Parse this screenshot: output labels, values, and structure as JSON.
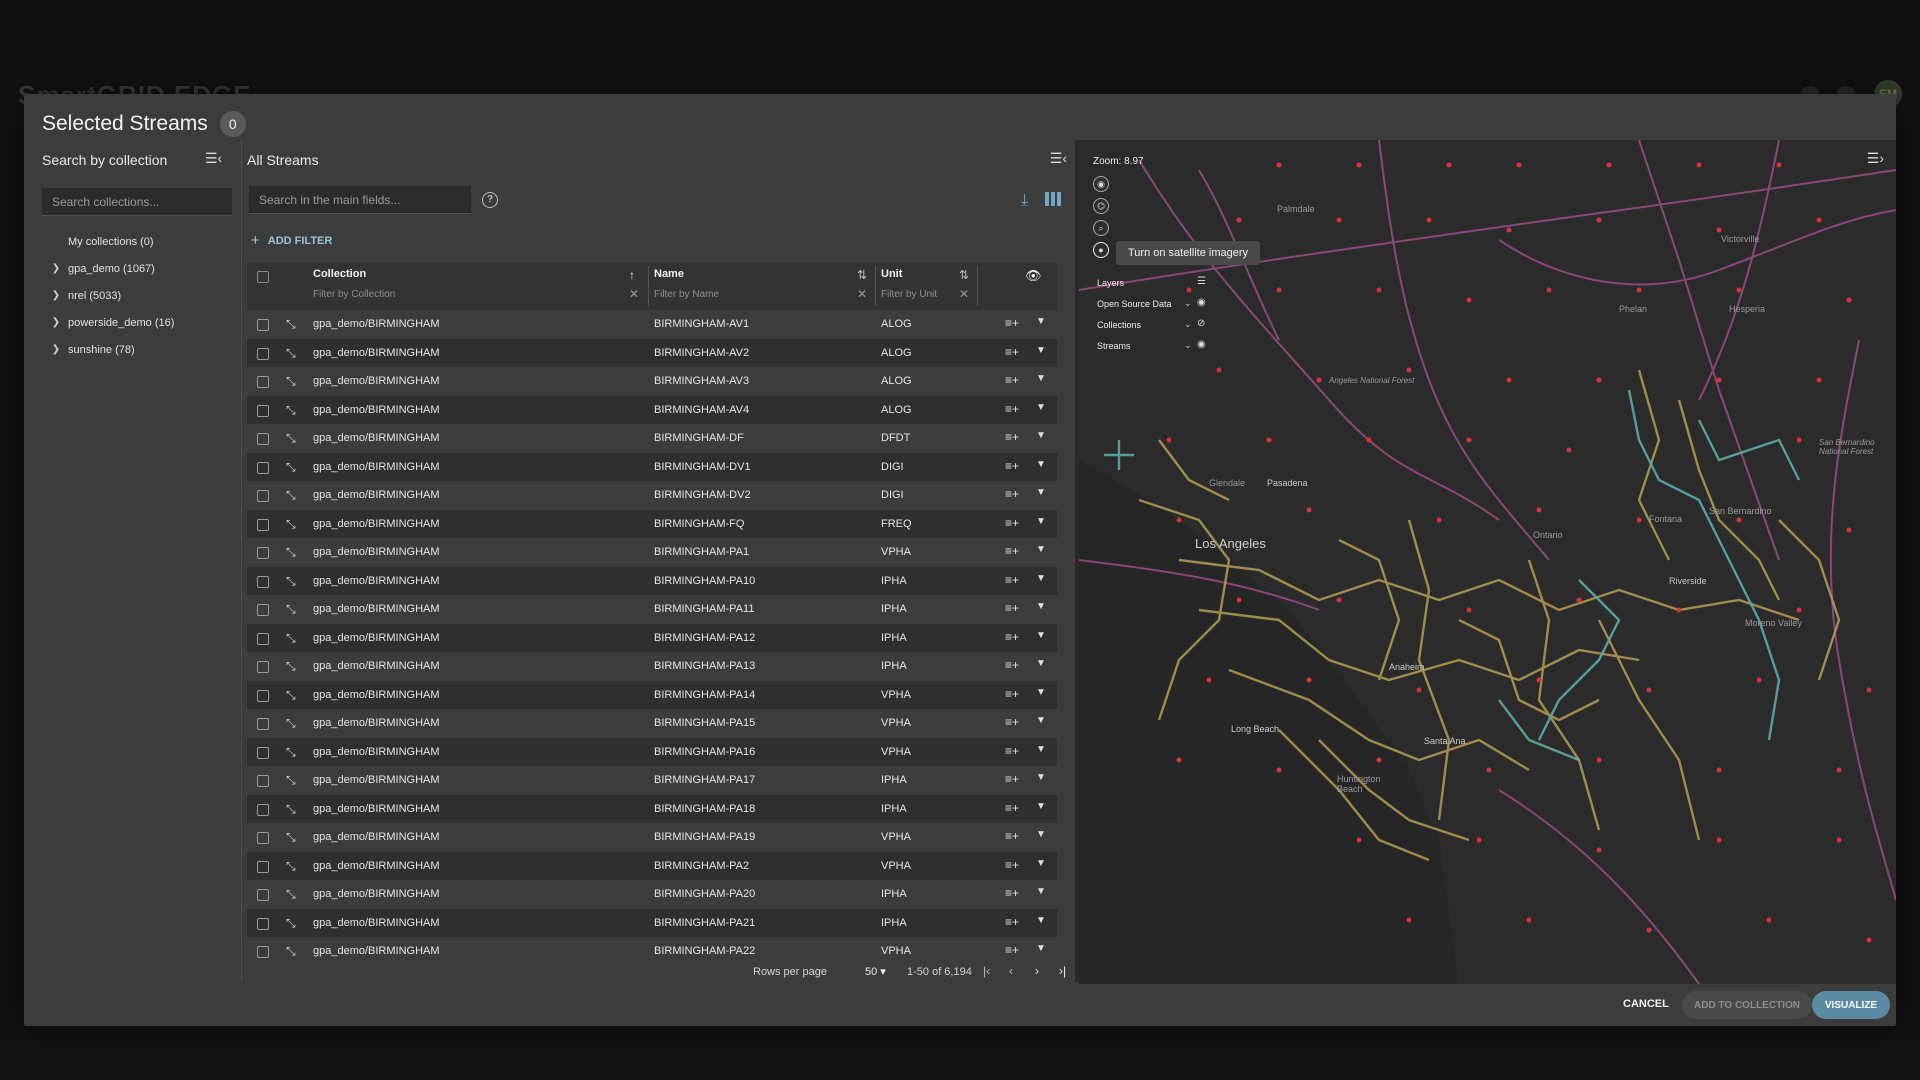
{
  "background": {
    "app_title": "SmartGRID EDGE",
    "avatar": "EM"
  },
  "dialog": {
    "title": "Selected Streams",
    "selected_count": "0"
  },
  "left_panel": {
    "title": "Search by collection",
    "search_placeholder": "Search collections...",
    "items": [
      {
        "label": "My collections (0)",
        "expandable": false
      },
      {
        "label": "gpa_demo (1067)",
        "expandable": true
      },
      {
        "label": "nrel (5033)",
        "expandable": true
      },
      {
        "label": "powerside_demo (16)",
        "expandable": true
      },
      {
        "label": "sunshine (78)",
        "expandable": true
      }
    ]
  },
  "streams": {
    "title": "All Streams",
    "search_placeholder": "Search in the main fields...",
    "add_filter_label": "ADD FILTER",
    "columns": {
      "collection": "Collection",
      "collection_filter": "Filter by Collection",
      "name": "Name",
      "name_filter": "Filter by Name",
      "unit": "Unit",
      "unit_filter": "Filter by Unit"
    },
    "rows": [
      {
        "collection": "gpa_demo/BIRMINGHAM",
        "name": "BIRMINGHAM-AV1",
        "unit": "ALOG"
      },
      {
        "collection": "gpa_demo/BIRMINGHAM",
        "name": "BIRMINGHAM-AV2",
        "unit": "ALOG"
      },
      {
        "collection": "gpa_demo/BIRMINGHAM",
        "name": "BIRMINGHAM-AV3",
        "unit": "ALOG"
      },
      {
        "collection": "gpa_demo/BIRMINGHAM",
        "name": "BIRMINGHAM-AV4",
        "unit": "ALOG"
      },
      {
        "collection": "gpa_demo/BIRMINGHAM",
        "name": "BIRMINGHAM-DF",
        "unit": "DFDT"
      },
      {
        "collection": "gpa_demo/BIRMINGHAM",
        "name": "BIRMINGHAM-DV1",
        "unit": "DIGI"
      },
      {
        "collection": "gpa_demo/BIRMINGHAM",
        "name": "BIRMINGHAM-DV2",
        "unit": "DIGI"
      },
      {
        "collection": "gpa_demo/BIRMINGHAM",
        "name": "BIRMINGHAM-FQ",
        "unit": "FREQ"
      },
      {
        "collection": "gpa_demo/BIRMINGHAM",
        "name": "BIRMINGHAM-PA1",
        "unit": "VPHA"
      },
      {
        "collection": "gpa_demo/BIRMINGHAM",
        "name": "BIRMINGHAM-PA10",
        "unit": "IPHA"
      },
      {
        "collection": "gpa_demo/BIRMINGHAM",
        "name": "BIRMINGHAM-PA11",
        "unit": "IPHA"
      },
      {
        "collection": "gpa_demo/BIRMINGHAM",
        "name": "BIRMINGHAM-PA12",
        "unit": "IPHA"
      },
      {
        "collection": "gpa_demo/BIRMINGHAM",
        "name": "BIRMINGHAM-PA13",
        "unit": "IPHA"
      },
      {
        "collection": "gpa_demo/BIRMINGHAM",
        "name": "BIRMINGHAM-PA14",
        "unit": "VPHA"
      },
      {
        "collection": "gpa_demo/BIRMINGHAM",
        "name": "BIRMINGHAM-PA15",
        "unit": "VPHA"
      },
      {
        "collection": "gpa_demo/BIRMINGHAM",
        "name": "BIRMINGHAM-PA16",
        "unit": "VPHA"
      },
      {
        "collection": "gpa_demo/BIRMINGHAM",
        "name": "BIRMINGHAM-PA17",
        "unit": "IPHA"
      },
      {
        "collection": "gpa_demo/BIRMINGHAM",
        "name": "BIRMINGHAM-PA18",
        "unit": "IPHA"
      },
      {
        "collection": "gpa_demo/BIRMINGHAM",
        "name": "BIRMINGHAM-PA19",
        "unit": "VPHA"
      },
      {
        "collection": "gpa_demo/BIRMINGHAM",
        "name": "BIRMINGHAM-PA2",
        "unit": "VPHA"
      },
      {
        "collection": "gpa_demo/BIRMINGHAM",
        "name": "BIRMINGHAM-PA20",
        "unit": "IPHA"
      },
      {
        "collection": "gpa_demo/BIRMINGHAM",
        "name": "BIRMINGHAM-PA21",
        "unit": "IPHA"
      },
      {
        "collection": "gpa_demo/BIRMINGHAM",
        "name": "BIRMINGHAM-PA22",
        "unit": "VPHA"
      }
    ],
    "pagination": {
      "rows_per_page_label": "Rows per page",
      "rows_per_page": "50",
      "range": "1-50 of 6,194"
    }
  },
  "map": {
    "zoom_label": "Zoom: 8.97",
    "tooltip": "Turn on satellite imagery",
    "layers_title": "Layers",
    "layers": [
      {
        "label": "Open Source Data",
        "visible": true
      },
      {
        "label": "Collections",
        "visible": false
      },
      {
        "label": "Streams",
        "visible": true
      }
    ],
    "places": {
      "la": "Los Angeles",
      "palmdale": "Palmdale",
      "victorville": "Victorville",
      "hesperia": "Hesperia",
      "pasadena": "Pasadena",
      "glendale": "Glendale",
      "long_beach": "Long Beach",
      "anaheim": "Anaheim",
      "santa_ana": "Santa Ana",
      "riverside": "Riverside",
      "ontario": "Ontario",
      "fontana": "Fontana",
      "moreno_valley": "Moreno Valley",
      "sb": "San Bernardino",
      "huntington_beach": "Huntington Beach",
      "angeles_nf": "Angeles National Forest",
      "sb_nf": "San Bernardino National Forest",
      "phelan": "Phelan"
    },
    "colors": {
      "grid_lines": "#b59d55",
      "highlight_lines": "#5ea9a9",
      "roads": "#a24f8a",
      "markers": "#d9323c"
    }
  },
  "footer": {
    "cancel": "CANCEL",
    "add_to_collection": "ADD TO COLLECTION",
    "visualize": "VISUALIZE"
  }
}
